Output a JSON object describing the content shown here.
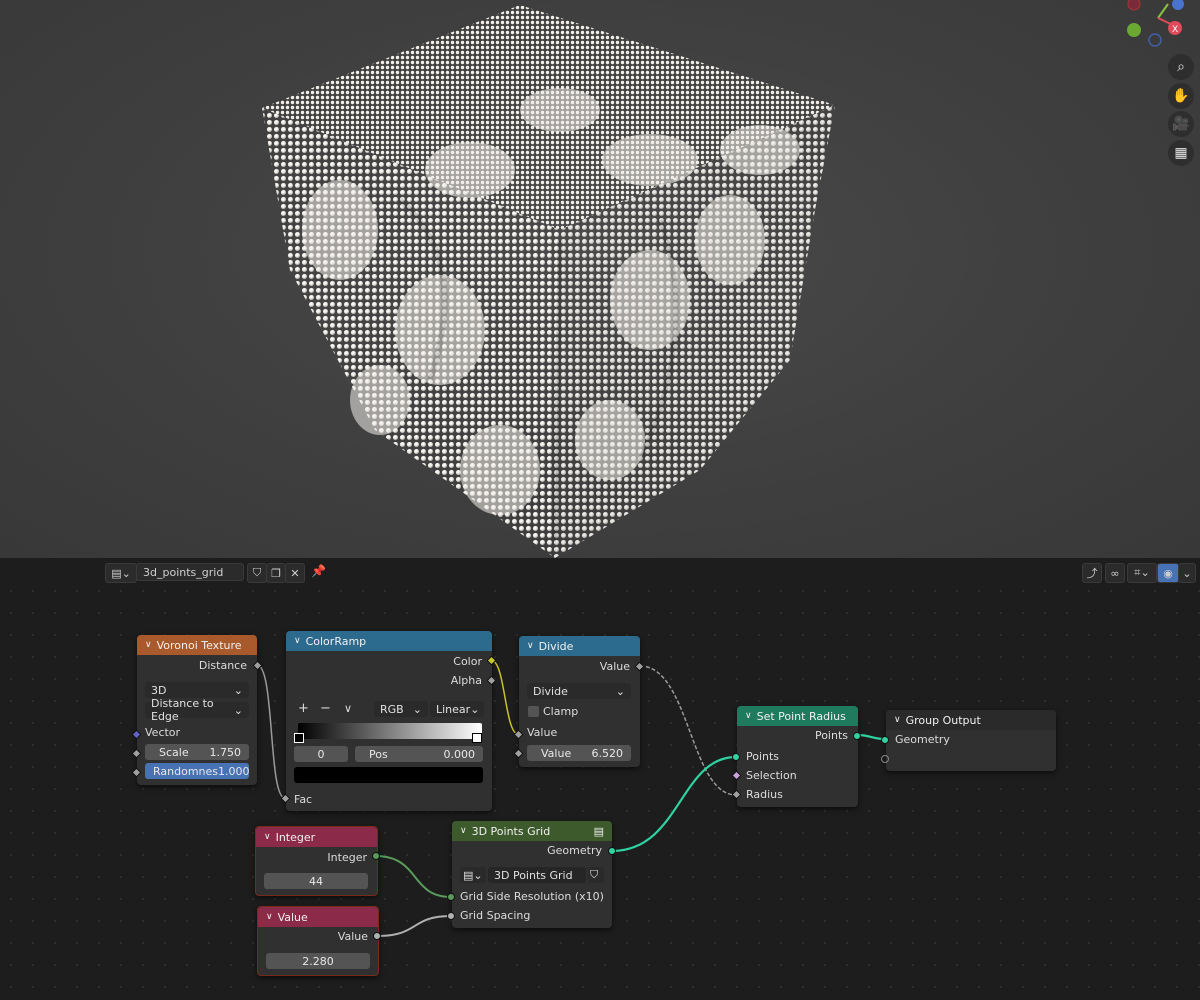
{
  "header": {
    "editor_type_icon": "node-editor-icon",
    "node_tree_name": "3d_points_grid",
    "fake_user_icon": "shield-icon",
    "duplicate_icon": "copy-icon",
    "close_icon": "close-icon",
    "pin_icon": "pin-icon"
  },
  "viewport": {
    "tools": [
      "zoom-icon",
      "hand-icon",
      "camera-icon",
      "grid-icon"
    ]
  },
  "nodes": {
    "voronoi": {
      "title": "Voronoi Texture",
      "output": "Distance",
      "dimension": "3D",
      "feature": "Distance to Edge",
      "vector_label": "Vector",
      "scale_label": "Scale",
      "scale_value": "1.750",
      "random_label": "Randomnes",
      "random_value": "1.000",
      "color": "#a85a2d"
    },
    "colorramp": {
      "title": "ColorRamp",
      "out_color": "Color",
      "out_alpha": "Alpha",
      "plus": "+",
      "minus": "−",
      "more": "∨",
      "mode": "RGB",
      "interp": "Linear",
      "index": "0",
      "pos_label": "Pos",
      "pos_value": "0.000",
      "input": "Fac",
      "color": "#2d6b8e"
    },
    "divide": {
      "title": "Divide",
      "output": "Value",
      "operation": "Divide",
      "clamp": "Clamp",
      "in_value": "Value",
      "value_label": "Value",
      "value": "6.520",
      "color": "#2d6b8e"
    },
    "setradius": {
      "title": "Set Point Radius",
      "output": "Points",
      "in_points": "Points",
      "in_selection": "Selection",
      "in_radius": "Radius",
      "color": "#1f7a5e"
    },
    "groupout": {
      "title": "Group Output",
      "in_geometry": "Geometry",
      "color": "#2a2a2a"
    },
    "integer": {
      "title": "Integer",
      "output": "Integer",
      "value": "44",
      "color": "#8c2a4a"
    },
    "value": {
      "title": "Value",
      "output": "Value",
      "value": "2.280",
      "color": "#8c2a4a"
    },
    "pointsgrid": {
      "title": "3D Points Grid",
      "output": "Geometry",
      "group_name": "3D Points Grid",
      "in_resolution": "Grid Side Resolution (x10)",
      "in_spacing": "Grid Spacing",
      "color": "#3d5a2c"
    }
  }
}
